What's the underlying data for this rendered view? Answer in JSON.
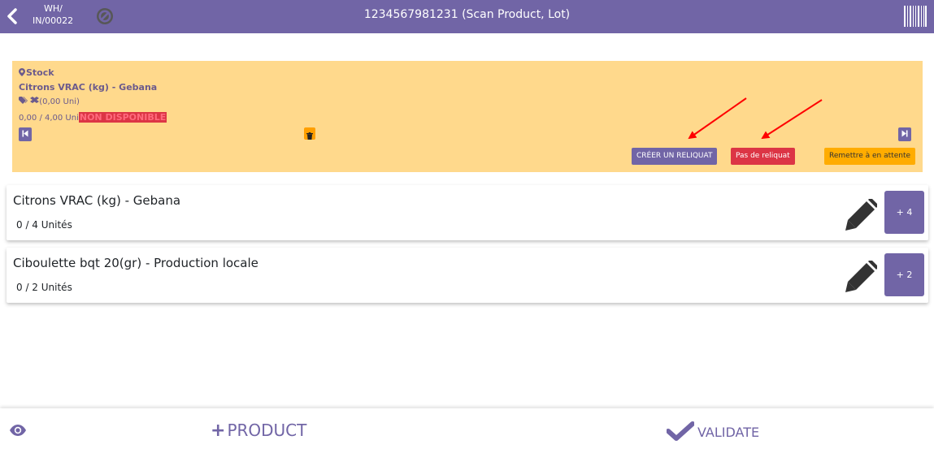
{
  "header": {
    "reference_line1": "WH/",
    "reference_line2": "IN/00022",
    "title": "1234567981231 (Scan Product, Lot)",
    "icons": [
      "back-arrow-icon",
      "no-entry-icon",
      "barcode-icon"
    ]
  },
  "stock_panel": {
    "location": "Stock",
    "product": "Citrons VRAC (kg) - Gebana",
    "tags_text": "(0,00 Uni)",
    "qty_done": "0,00",
    "qty_text": " / 4,00 Uni",
    "status_badge": "NON DISPONIBLE",
    "buttons": {
      "create_backorder": "CRÉER UN RELIQUAT",
      "no_backorder": "Pas de reliquat",
      "put_on_hold": "Remettre à en attente"
    }
  },
  "lines": [
    {
      "name": "Citrons VRAC (kg) - Gebana",
      "qty": "0 / 4 Unités",
      "increment": "+ 4"
    },
    {
      "name": "Ciboulette bqt 20(gr) - Production locale",
      "qty": "0 / 2 Unités",
      "increment": "+ 2"
    }
  ],
  "footer": {
    "add_product_label": "PRODUCT",
    "validate_label": "VALIDATE"
  },
  "colors": {
    "primary": "#7165a6",
    "panel_bg": "#ffd98c",
    "danger": "#dc3545",
    "warning": "#ffac00",
    "annotation_arrow": "#ff0000"
  }
}
